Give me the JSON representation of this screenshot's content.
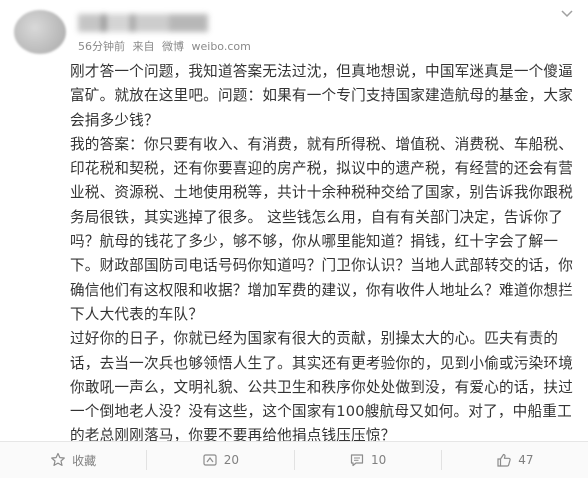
{
  "post": {
    "meta": {
      "time": "56分钟前",
      "source_prefix": "来自",
      "source_name": "微博",
      "source_url": "weibo.com"
    },
    "paragraphs": [
      "刚才答一个问题，我知道答案无法过沈，但真地想说，中国军迷真是一个傻逼富矿。就放在这里吧。问题：如果有一个专门支持国家建造航母的基金，大家会捐多少钱？",
      "我的答案：你只要有收入、有消费，就有所得税、增值税、消费税、车船税、印花税和契税，还有你要喜迎的房产税，拟议中的遗产税，有经营的还会有营业税、资源税、土地使用税等，共计十余种税种交给了国家，别告诉我你跟税务局很铁，其实逃掉了很多。 这些钱怎么用，自有有关部门决定，告诉你了吗？航母的钱花了多少，够不够，你从哪里能知道？捐钱，红十字会了解一下。财政部国防司电话号码你知道吗？门卫你认识？当地人武部转交的话，你确信他们有这权限和收据？增加军费的建议，你有收件人地址么？难道你想拦下人大代表的车队？",
      "过好你的日子，你就已经为国家有很大的贡献，别操太大的心。匹夫有责的话，去当一次兵也够领悟人生了。其实还有更考验你的，见到小偷或污染环境你敢吼一声么，文明礼貌、公共卫生和秩序你处处做到没，有爱心的话，扶过一个倒地老人没？没有这些，这个国家有100艘航母又如何。对了，中船重工的老总刚刚落马，你要不要再给他捐点钱压压惊？"
    ]
  },
  "footer": {
    "favorite_label": "收藏",
    "repost_count": "20",
    "comment_count": "10",
    "like_count": "47"
  },
  "icons": {
    "favorite": "star-icon",
    "repost": "repost-icon",
    "comment": "comment-icon",
    "like": "thumbs-up-icon",
    "menu": "chevron-down-icon"
  },
  "colors": {
    "text": "#333333",
    "meta": "#8a8a8a",
    "footer_bg": "#fafafa"
  }
}
